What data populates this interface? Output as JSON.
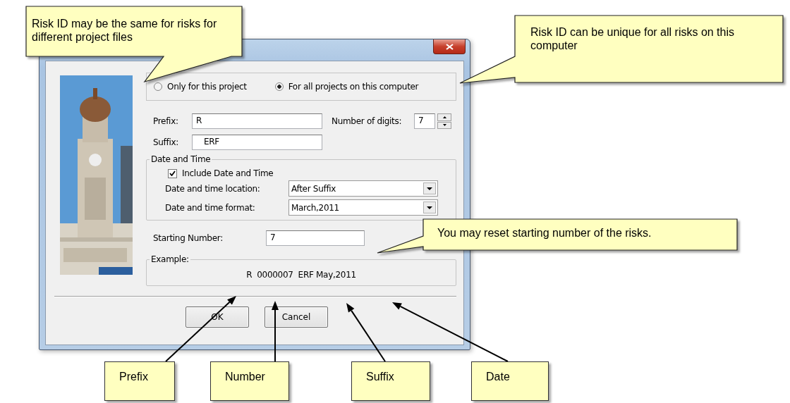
{
  "dialog": {
    "scope_options": [
      {
        "label": "Only for this project",
        "selected": false
      },
      {
        "label": "For all projects on this computer",
        "selected": true
      }
    ],
    "prefix": {
      "label": "Prefix:",
      "value": "R"
    },
    "number_of_digits": {
      "label": "Number of digits:",
      "value": "7"
    },
    "suffix": {
      "label": "Suffix:",
      "value": "ERF"
    },
    "date_and_time": {
      "title": "Date and Time",
      "include": {
        "label": "Include Date and Time",
        "checked": true
      },
      "location": {
        "label": "Date and time location:",
        "value": "After Suffix"
      },
      "format": {
        "label": "Date and time format:",
        "value": "March,2011"
      }
    },
    "starting_number": {
      "label": "Starting Number:",
      "value": "7"
    },
    "example": {
      "title": "Example:",
      "text": "R  0000007  ERF May,2011"
    },
    "buttons": [
      "OK",
      "Cancel"
    ]
  },
  "callouts": [
    {
      "text": "Risk ID may be the same for risks for different project files"
    },
    {
      "text": "Risk ID can be unique for all risks on this computer"
    },
    {
      "text": "You may reset starting number of the risks."
    }
  ],
  "labels": [
    "Prefix",
    "Number",
    "Suffix",
    "Date"
  ]
}
